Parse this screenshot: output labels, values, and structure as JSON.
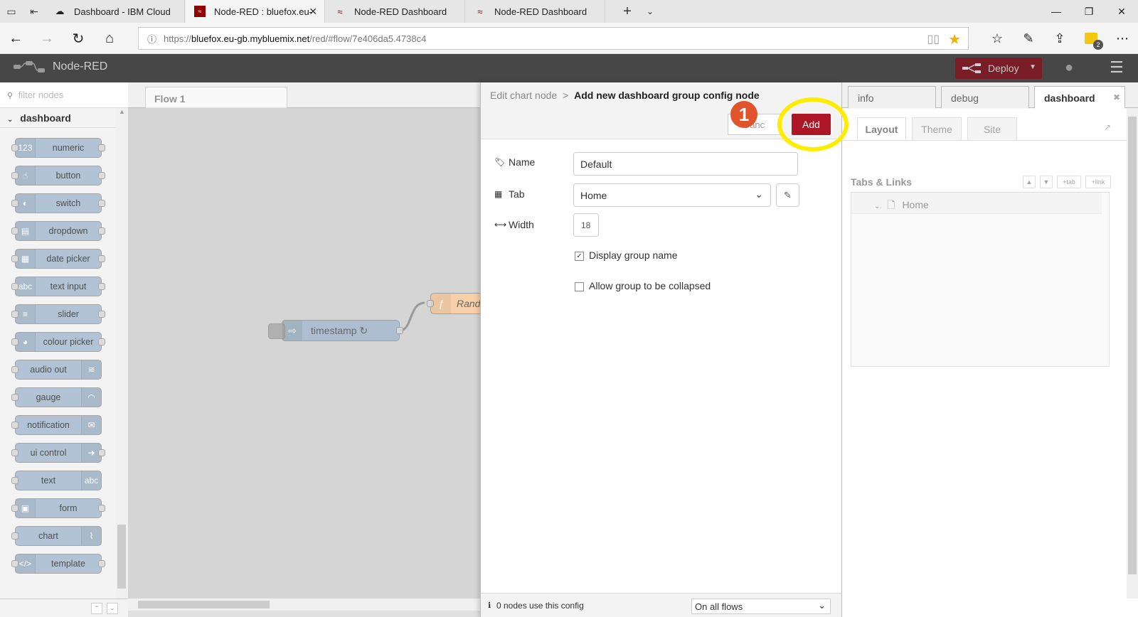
{
  "browser": {
    "tabs": [
      {
        "title": "Dashboard - IBM Cloud"
      },
      {
        "title": "Node-RED : bluefox.eu-"
      },
      {
        "title": "Node-RED Dashboard"
      },
      {
        "title": "Node-RED Dashboard"
      }
    ],
    "url_prefix": "https://",
    "url_domain": "bluefox.eu-gb.mybluemix.net",
    "url_path": "/red/#flow/7e406da5.4738c4",
    "notification_count": "2"
  },
  "app": {
    "name": "Node-RED",
    "deploy_label": "Deploy"
  },
  "palette": {
    "filter_placeholder": "filter nodes",
    "category": "dashboard",
    "nodes": [
      {
        "label": "numeric",
        "icon": "123"
      },
      {
        "label": "button",
        "icon": "☝"
      },
      {
        "label": "switch",
        "icon": "◐"
      },
      {
        "label": "dropdown",
        "icon": "▤"
      },
      {
        "label": "date picker",
        "icon": "▦"
      },
      {
        "label": "text input",
        "icon": "abc"
      },
      {
        "label": "slider",
        "icon": "≡"
      },
      {
        "label": "colour picker",
        "icon": "◕"
      },
      {
        "label": "audio out",
        "icon": "≋"
      },
      {
        "label": "gauge",
        "icon": "◠"
      },
      {
        "label": "notification",
        "icon": "✉"
      },
      {
        "label": "ui control",
        "icon": "➜"
      },
      {
        "label": "text",
        "icon": "abc"
      },
      {
        "label": "form",
        "icon": "▣"
      },
      {
        "label": "chart",
        "icon": "⌇"
      },
      {
        "label": "template",
        "icon": "</>"
      }
    ]
  },
  "workspace": {
    "flow_tab": "Flow 1",
    "inject_node_label": "timestamp ↻",
    "function_node_label": "Rand"
  },
  "tray": {
    "breadcrumb_parent": "Edit chart node",
    "breadcrumb_sep": ">",
    "title": "Add new dashboard group config node",
    "cancel_label": "Canc",
    "add_label": "Add",
    "name_label": "Name",
    "name_value": "Default",
    "tab_label": "Tab",
    "tab_value": "Home",
    "width_label": "Width",
    "width_value": "18",
    "display_group_label": "Display group name",
    "display_group_checked": true,
    "collapse_label": "Allow group to be collapsed",
    "collapse_checked": false,
    "footer_usage": "0 nodes use this config",
    "footer_scope": "On all flows"
  },
  "sidebar": {
    "tabs": [
      {
        "label": "info"
      },
      {
        "label": "debug"
      },
      {
        "label": "dashboard"
      }
    ],
    "subtabs": [
      {
        "label": "Layout"
      },
      {
        "label": "Theme"
      },
      {
        "label": "Site"
      }
    ],
    "section_title": "Tabs & Links",
    "mini_buttons": [
      "▲",
      "▼",
      "+tab",
      "+link"
    ],
    "tree_item": "Home"
  },
  "annotation": {
    "step_number": "1",
    "highlight_color": "#ffec00",
    "badge_color": "#e0542b"
  },
  "colors": {
    "header_bg": "#474747",
    "deploy_bg": "#8c101c",
    "add_button_bg": "#ad1625",
    "node_bg": "#a6bbcf"
  }
}
